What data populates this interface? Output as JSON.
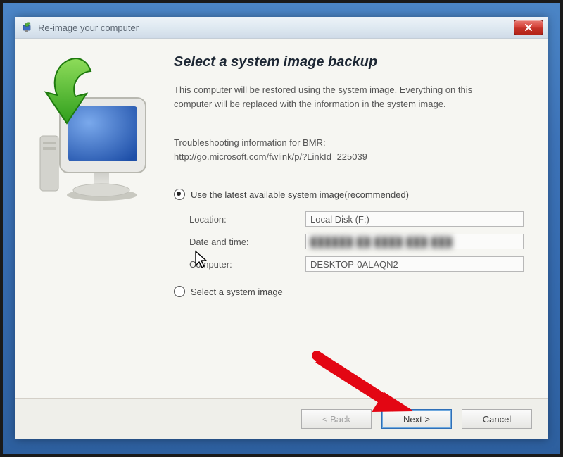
{
  "window": {
    "title": "Re-image your computer"
  },
  "main": {
    "heading": "Select a system image backup",
    "description": "This computer will be restored using the system image. Everything on this computer will be replaced with the information in the system image.",
    "troubleshooting_label": "Troubleshooting information for BMR:",
    "troubleshooting_url": "http://go.microsoft.com/fwlink/p/?LinkId=225039",
    "option_latest_label": "Use the latest available system image(recommended)",
    "option_select_label": "Select a system image",
    "selected_option": "latest",
    "fields": {
      "location_label": "Location:",
      "location_value": "Local Disk (F:)",
      "datetime_label": "Date and time:",
      "datetime_value": "██████ ██ ████ ███ ███",
      "computer_label": "Computer:",
      "computer_value": "DESKTOP-0ALAQN2"
    }
  },
  "buttons": {
    "back": "< Back",
    "next": "Next >",
    "cancel": "Cancel"
  }
}
